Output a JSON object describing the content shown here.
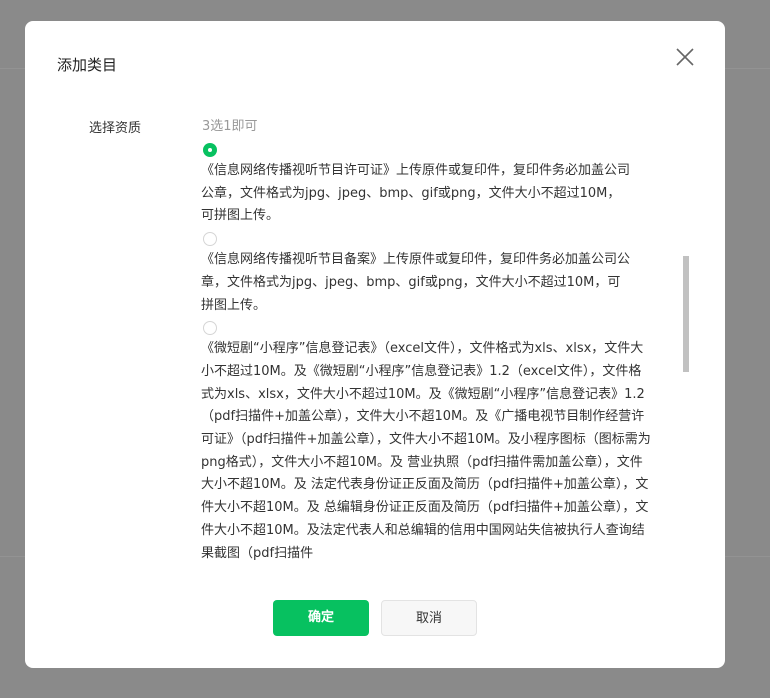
{
  "dialog": {
    "title": "添加类目",
    "close_icon": "close-icon"
  },
  "form": {
    "field_label": "选择资质",
    "hint": "3选1即可",
    "selected_index": 0,
    "options": [
      {
        "checked": true,
        "text": "《信息网络传播视听节目许可证》上传原件或复印件，复印件务必加盖公司公章，文件格式为jpg、jpeg、bmp、gif或png，文件大小不超过10M，可拼图上传。"
      },
      {
        "checked": false,
        "text": "《信息网络传播视听节目备案》上传原件或复印件，复印件务必加盖公司公章，文件格式为jpg、jpeg、bmp、gif或png，文件大小不超过10M，可拼图上传。"
      },
      {
        "checked": false,
        "text": "《微短剧“小程序”信息登记表》（excel文件），文件格式为xls、xlsx，文件大小不超过10M。及《微短剧“小程序”信息登记表》1.2（excel文件），文件格式为xls、xlsx，文件大小不超过10M。及《微短剧“小程序”信息登记表》1.2（pdf扫描件+加盖公章），文件大小不超10M。及《广播电视节目制作经营许可证》（pdf扫描件+加盖公章），文件大小不超10M。及小程序图标（图标需为png格式），文件大小不超10M。及 营业执照（pdf扫描件需加盖公章），文件大小不超10M。及 法定代表身份证正反面及简历（pdf扫描件+加盖公章），文件大小不超10M。及 总编辑身份证正反面及简历（pdf扫描件+加盖公章），文件大小不超10M。及法定代表人和总编辑的信用中国网站失信被执行人查询结果截图（pdf扫描件"
      }
    ]
  },
  "footer": {
    "confirm_label": "确定",
    "cancel_label": "取消"
  },
  "colors": {
    "primary": "#07c160",
    "overlay": "#8a8a8a",
    "scroll_thumb": "#c1c1c1"
  }
}
